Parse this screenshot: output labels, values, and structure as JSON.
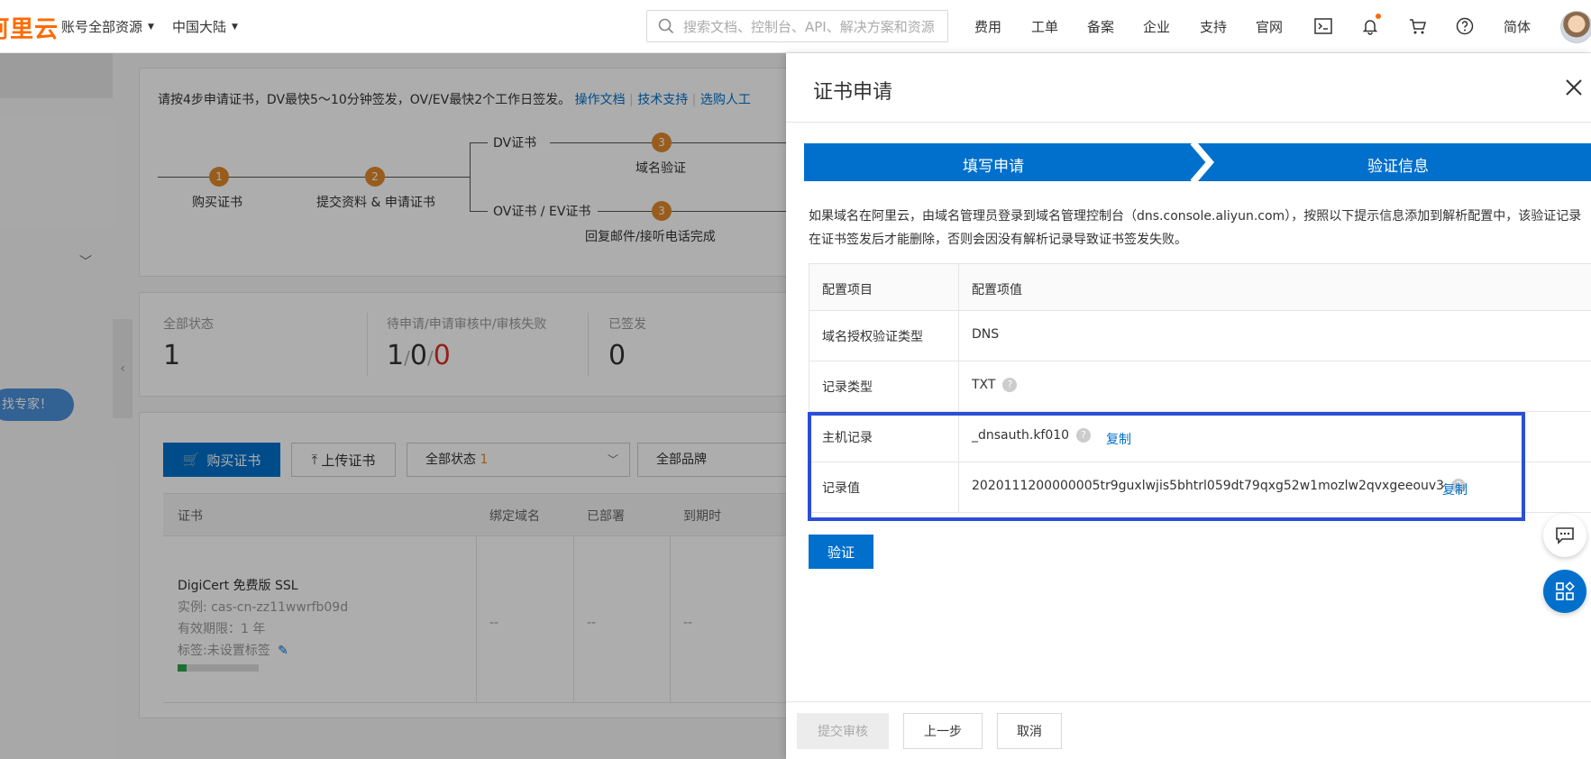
{
  "topbar": {
    "logo": "阿里云",
    "account_menu": "账号全部资源",
    "region": "中国大陆",
    "search_placeholder": "搜索文档、控制台、API、解决方案和资源",
    "nav": [
      "费用",
      "工单",
      "备案",
      "企业",
      "支持",
      "官网"
    ],
    "language": "简体"
  },
  "background": {
    "expert_button": "找专家！",
    "intro": "请按4步申请证书，DV最快5～10分钟签发，OV/EV最快2个工作日签发。",
    "intro_links": [
      "操作文档",
      "技术支持",
      "选购人工"
    ],
    "steps": {
      "s1_num": "1",
      "s1_label": "购买证书",
      "s2_num": "2",
      "s2_label": "提交资料 & 申请证书",
      "dv_label": "DV证书",
      "dv_num": "3",
      "dv_step": "域名验证",
      "ov_label": "OV证书 / EV证书",
      "ov_num": "3",
      "ov_step": "回复邮件/接听电话完成"
    },
    "stats": {
      "all_label": "全部状态",
      "all_value": "1",
      "pending_label": "待申请/申请审核中/审核失败",
      "pending_a": "1",
      "pending_sep": "/",
      "pending_b": "0",
      "pending_c": "0",
      "issued_label": "已签发",
      "issued_value": "0"
    },
    "toolbar": {
      "buy": "购买证书",
      "upload": "上传证书",
      "status_filter": "全部状态",
      "status_count": "1",
      "brand_filter": "全部品牌"
    },
    "table": {
      "headers": [
        "证书",
        "绑定域名",
        "已部署",
        "到期时"
      ],
      "row": {
        "name": "DigiCert 免费版 SSL",
        "instance": "实例: cas-cn-zz11wwrfb09d",
        "validity": "有效期限：1 年",
        "tags": "标签:未设置标签",
        "dash": "--"
      }
    }
  },
  "drawer": {
    "title": "证书申请",
    "step1": "填写申请",
    "step2": "验证信息",
    "description": "如果域名在阿里云，由域名管理员登录到域名管理控制台（dns.console.aliyun.com），按照以下提示信息添加到解析配置中，该验证记录在证书签发后才能删除，否则会因没有解析记录导致证书签发失败。",
    "table_header": {
      "key": "配置项目",
      "value": "配置项值"
    },
    "rows": {
      "auth_type_key": "域名授权验证类型",
      "auth_type_val": "DNS",
      "record_type_key": "记录类型",
      "record_type_val": "TXT",
      "host_key": "主机记录",
      "host_val": "_dnsauth.kf010",
      "value_key": "记录值",
      "value_val": "2020111200000005tr9guxlwjis5bhtrl059dt79qxg52w1mozlw2qvxgeeouv3"
    },
    "copy_label": "复制",
    "help_glyph": "?",
    "verify_button": "验证",
    "footer": {
      "submit": "提交审核",
      "prev": "上一步",
      "cancel": "取消"
    }
  },
  "colors": {
    "brand": "#ff6a00",
    "primary": "#0070cc",
    "highlight": "#2a4fd6",
    "step_orange": "#e08a2b"
  }
}
